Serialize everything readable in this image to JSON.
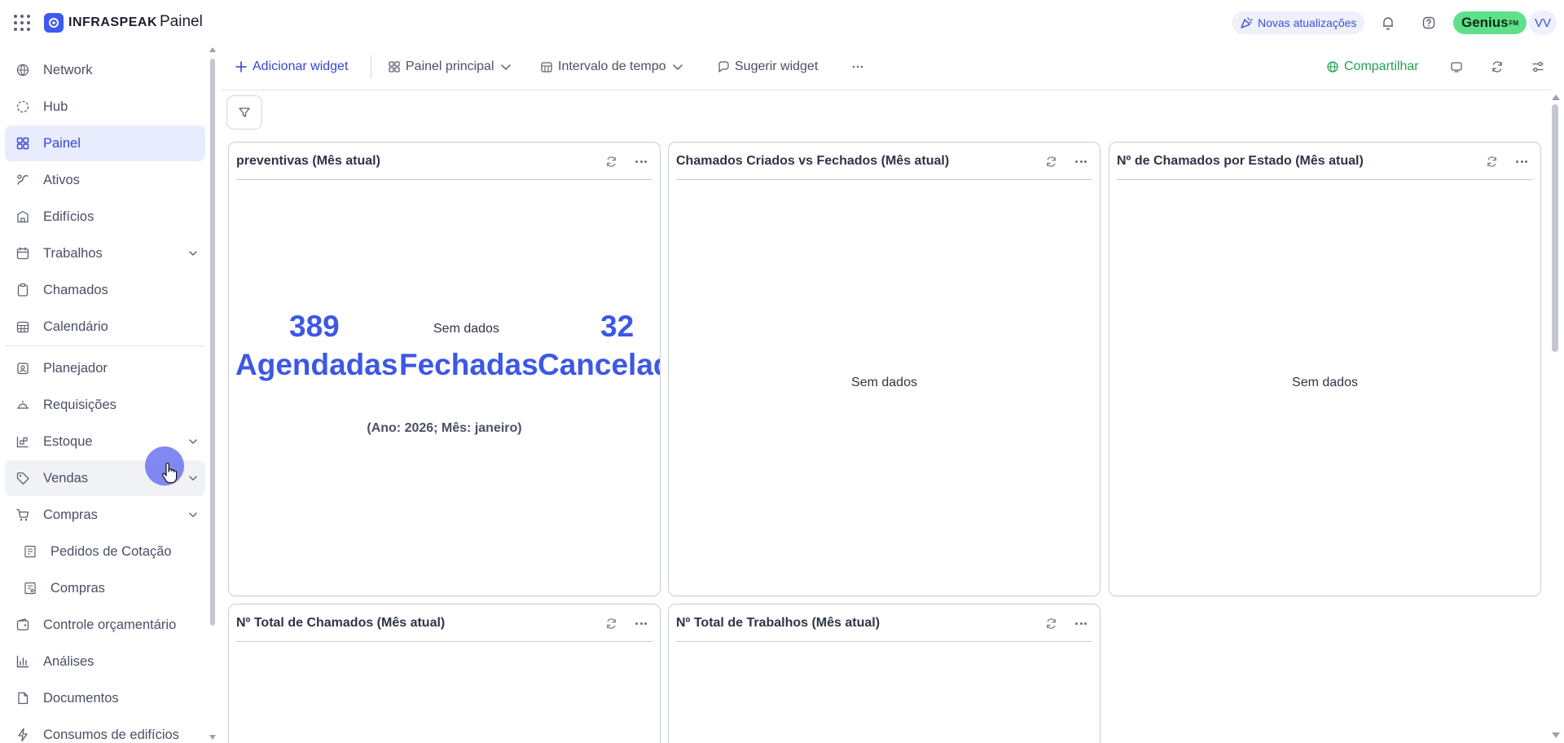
{
  "header": {
    "logo_text": "INFRASPEAK",
    "page_title": "Painel",
    "updates_label": "Novas atualizações",
    "genius_label": "Genius",
    "genius_sup": "FM",
    "avatar_initials": "VV"
  },
  "sidebar": {
    "items": [
      {
        "label": "Network",
        "icon": "network-icon"
      },
      {
        "label": "Hub",
        "icon": "hub-icon"
      },
      {
        "label": "Painel",
        "icon": "dashboard-icon",
        "active": true
      },
      {
        "label": "Ativos",
        "icon": "assets-icon"
      },
      {
        "label": "Edifícios",
        "icon": "building-icon"
      },
      {
        "label": "Trabalhos",
        "icon": "calendar-icon",
        "expandable": true
      },
      {
        "label": "Chamados",
        "icon": "clipboard-icon"
      },
      {
        "label": "Calendário",
        "icon": "calendar-grid-icon"
      },
      {
        "label": "Planejador",
        "icon": "planner-icon"
      },
      {
        "label": "Requisições",
        "icon": "bell-service-icon"
      },
      {
        "label": "Estoque",
        "icon": "stock-icon",
        "expandable": true
      },
      {
        "label": "Vendas",
        "icon": "tag-icon",
        "expandable": true
      },
      {
        "label": "Compras",
        "icon": "cart-icon",
        "expandable": true
      },
      {
        "label": "Pedidos de Cotação",
        "icon": "quote-request-icon",
        "sub": true
      },
      {
        "label": "Compras",
        "icon": "purchase-icon",
        "sub": true
      },
      {
        "label": "Controle orçamentário",
        "icon": "budget-icon"
      },
      {
        "label": "Análises",
        "icon": "bar-chart-icon"
      },
      {
        "label": "Documentos",
        "icon": "document-icon"
      },
      {
        "label": "Consumos de edifícios",
        "icon": "energy-icon"
      }
    ]
  },
  "toolbar": {
    "add_widget": "Adicionar widget",
    "dashboard_select": "Painel principal",
    "time_interval": "Intervalo de tempo",
    "suggest_widget": "Sugerir widget",
    "share": "Compartilhar"
  },
  "widgets": {
    "preventivas": {
      "title": "preventivas (Mês atual)",
      "scheduled_value": "389",
      "scheduled_label": "Agendadas",
      "closed_value": "Sem dados",
      "closed_label": "Fechadas",
      "cancelled_value": "32",
      "cancelled_label": "Cancelad",
      "period": "(Ano: 2026; Mês: janeiro)"
    },
    "created_vs_closed": {
      "title": "Chamados Criados vs Fechados (Mês atual)",
      "empty": "Sem dados"
    },
    "by_state": {
      "title": "Nº de Chamados por Estado (Mês atual)",
      "empty": "Sem dados"
    },
    "total_tickets": {
      "title": "Nº Total de Chamados (Mês atual)"
    },
    "total_jobs": {
      "title": "Nº Total de Trabalhos (Mês atual)"
    }
  },
  "colors": {
    "accent": "#3d57e6",
    "active_nav_bg": "#e9ecfc",
    "genius_bg": "#5fe08a",
    "share_green": "#22a352"
  }
}
